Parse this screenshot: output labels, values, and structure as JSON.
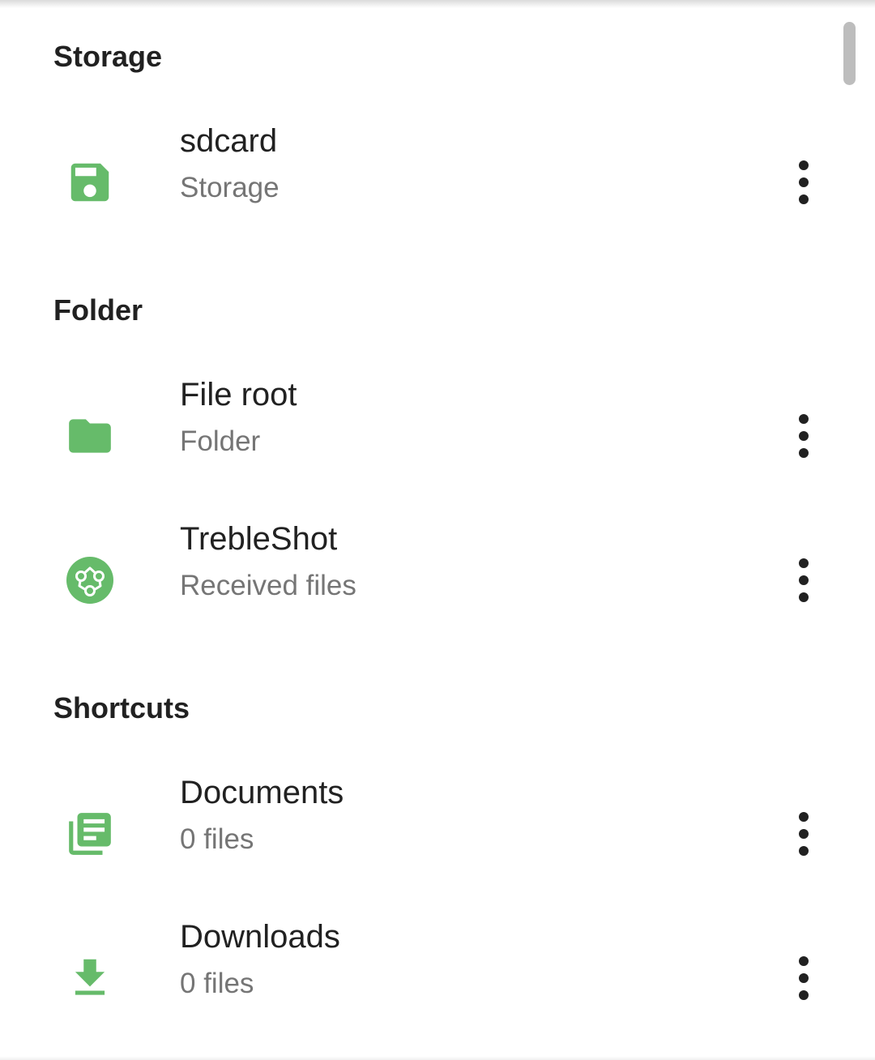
{
  "accent_color": "#66bb6a",
  "sections": {
    "storage": {
      "header": "Storage",
      "items": [
        {
          "title": "sdcard",
          "subtitle": "Storage",
          "icon": "sd-card-save-icon"
        }
      ]
    },
    "folder": {
      "header": "Folder",
      "items": [
        {
          "title": "File root",
          "subtitle": "Folder",
          "icon": "folder-icon"
        },
        {
          "title": "TrebleShot",
          "subtitle": "Received files",
          "icon": "trebleshot-share-icon"
        }
      ]
    },
    "shortcuts": {
      "header": "Shortcuts",
      "items": [
        {
          "title": "Documents",
          "subtitle": "0 files",
          "icon": "documents-icon"
        },
        {
          "title": "Downloads",
          "subtitle": "0 files",
          "icon": "download-icon"
        }
      ]
    }
  },
  "row_menu_icon": "more-vert-icon"
}
